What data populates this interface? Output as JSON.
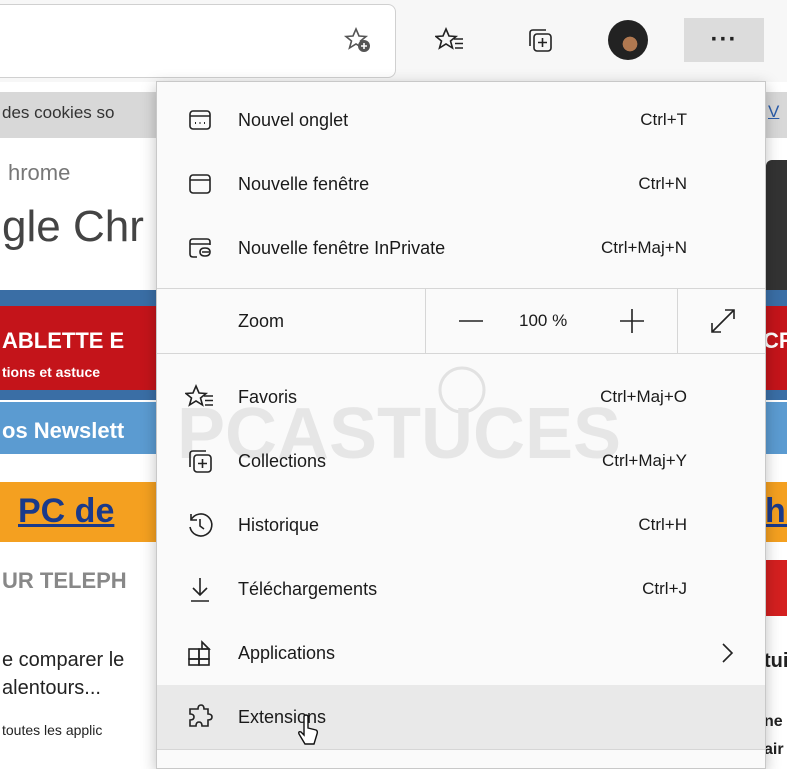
{
  "toolbar": {
    "icons": [
      "add-favorite-icon",
      "favorites-icon",
      "collections-icon",
      "profile-avatar",
      "more-options-icon"
    ],
    "menu_button_label": "···"
  },
  "page": {
    "cookie_text": "des cookies so",
    "cookie_link": "V",
    "chrome_small": "hrome",
    "chrome_big": "gle Chr",
    "red_title": "ABLETTE E",
    "red_subtitle": "tions et astuce",
    "red_right": "CR",
    "newsletter": "os Newslett",
    "orange_text": "PC de",
    "orange_right": "he",
    "phone_text": "UR TELEPH",
    "body_line1": "e comparer le",
    "body_line2": "alentours...",
    "body_small": "toutes les applic",
    "right_text1": "tui",
    "right_text2a": "ne",
    "right_text2b": "air",
    "colors": {
      "red": "#c4141a",
      "blue": "#5b9bd1",
      "orange": "#f4a020"
    }
  },
  "menu": {
    "items_top": [
      {
        "icon": "new-tab-icon",
        "label": "Nouvel onglet",
        "shortcut": "Ctrl+T"
      },
      {
        "icon": "new-window-icon",
        "label": "Nouvelle fenêtre",
        "shortcut": "Ctrl+N"
      },
      {
        "icon": "inprivate-window-icon",
        "label": "Nouvelle fenêtre InPrivate",
        "shortcut": "Ctrl+Maj+N"
      }
    ],
    "zoom": {
      "label": "Zoom",
      "value": "100 %",
      "minus": "zoom-out-icon",
      "plus": "zoom-in-icon",
      "fullscreen": "fullscreen-icon"
    },
    "items_bottom": [
      {
        "icon": "favorites-icon",
        "label": "Favoris",
        "shortcut": "Ctrl+Maj+O"
      },
      {
        "icon": "collections-icon",
        "label": "Collections",
        "shortcut": "Ctrl+Maj+Y"
      },
      {
        "icon": "history-icon",
        "label": "Historique",
        "shortcut": "Ctrl+H"
      },
      {
        "icon": "downloads-icon",
        "label": "Téléchargements",
        "shortcut": "Ctrl+J"
      },
      {
        "icon": "apps-icon",
        "label": "Applications",
        "shortcut": ""
      },
      {
        "icon": "extensions-icon",
        "label": "Extensions",
        "shortcut": ""
      }
    ],
    "hovered_item": "Extensions",
    "watermark_text": "PCASTUCES"
  }
}
